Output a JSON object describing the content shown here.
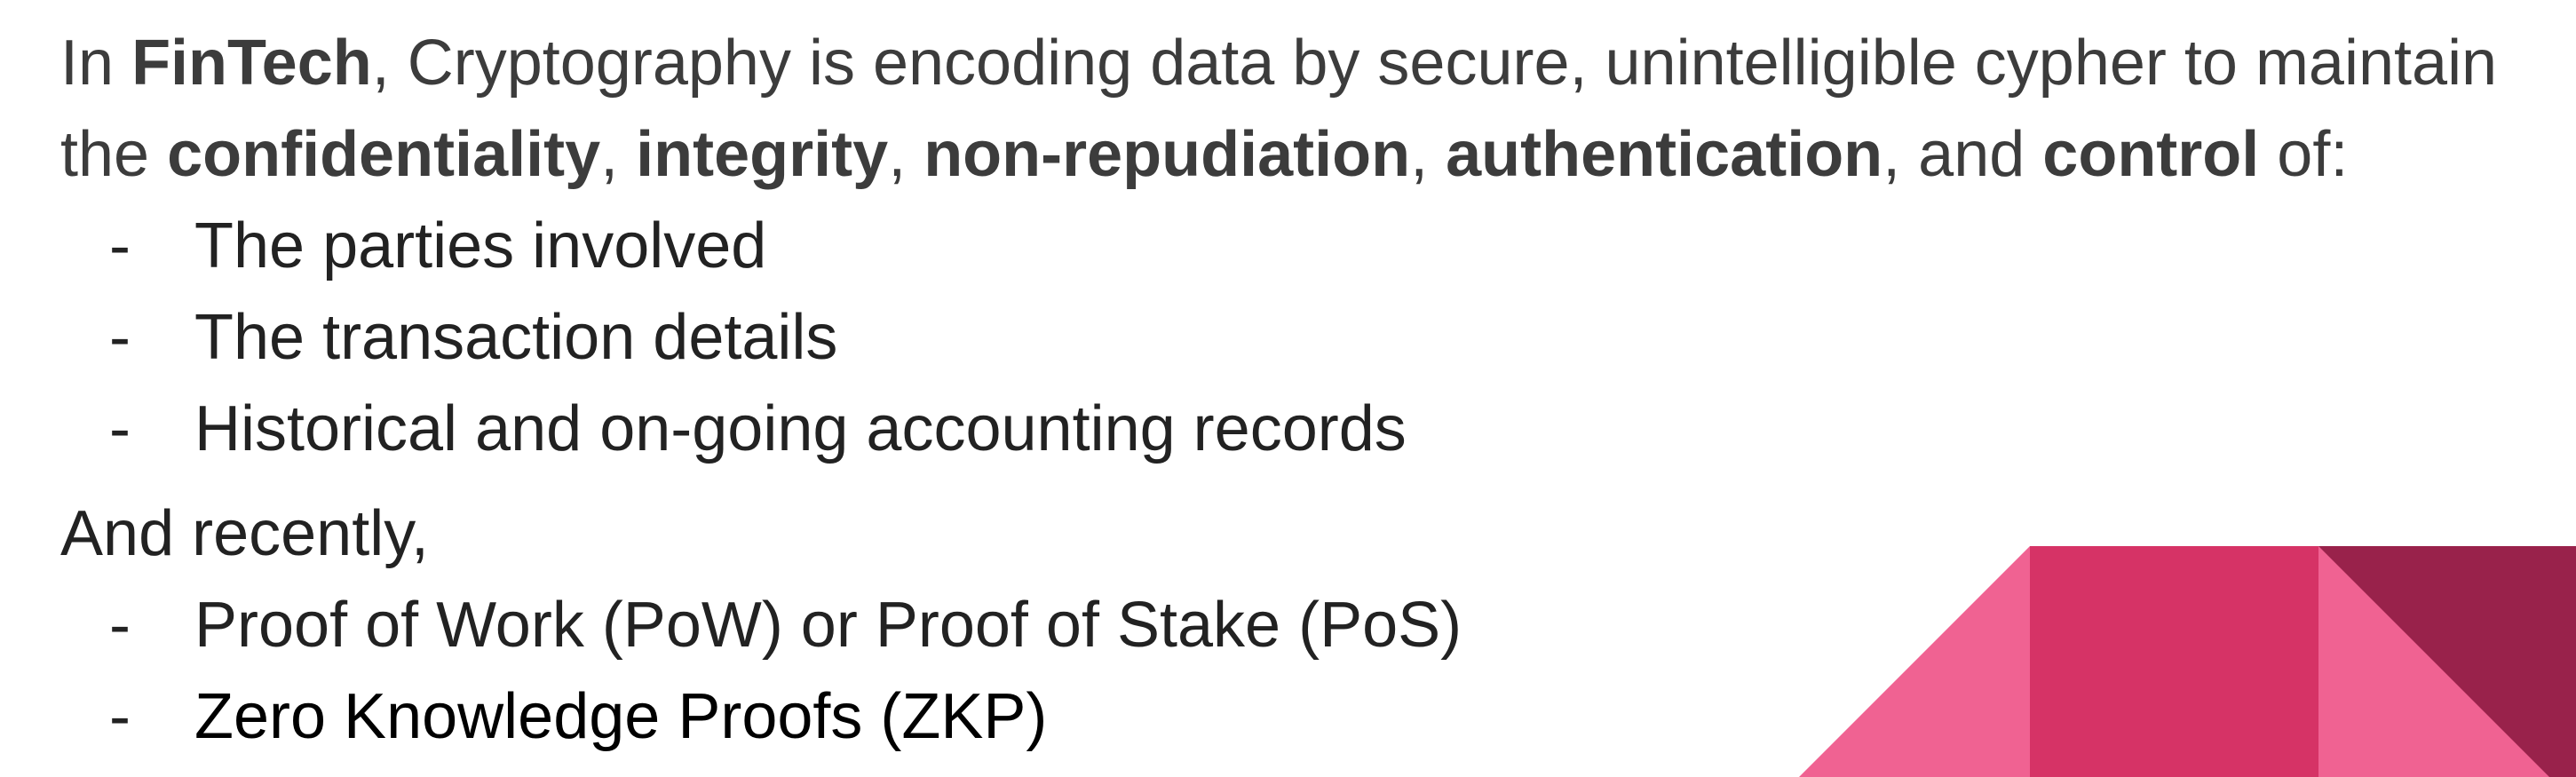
{
  "intro": {
    "p1": "In ",
    "fintech": "FinTech",
    "p2": ", Cryptography is encoding data by secure, unintelligible cypher to maintain",
    "p3": "the ",
    "confidentiality": "confidentiality",
    "sep1": ", ",
    "integrity": "integrity",
    "sep2": ", ",
    "non_repudiation": "non-repudiation",
    "sep3": ", ",
    "authentication": "authentication",
    "sep4": ", and ",
    "control": "control",
    "p4": " of:"
  },
  "list1": {
    "dash": "-",
    "items": [
      "The parties involved",
      "The transaction details",
      "Historical and on-going accounting records"
    ]
  },
  "recently": "And recently,",
  "list2": {
    "dash": "-",
    "items": [
      "Proof of Work (PoW) or Proof of Stake (PoS)",
      "Zero Knowledge Proofs (ZKP)"
    ]
  },
  "decoration": {
    "pink_light": "#F06292",
    "pink_mid": "#D63366",
    "pink_dark": "#99224B"
  }
}
